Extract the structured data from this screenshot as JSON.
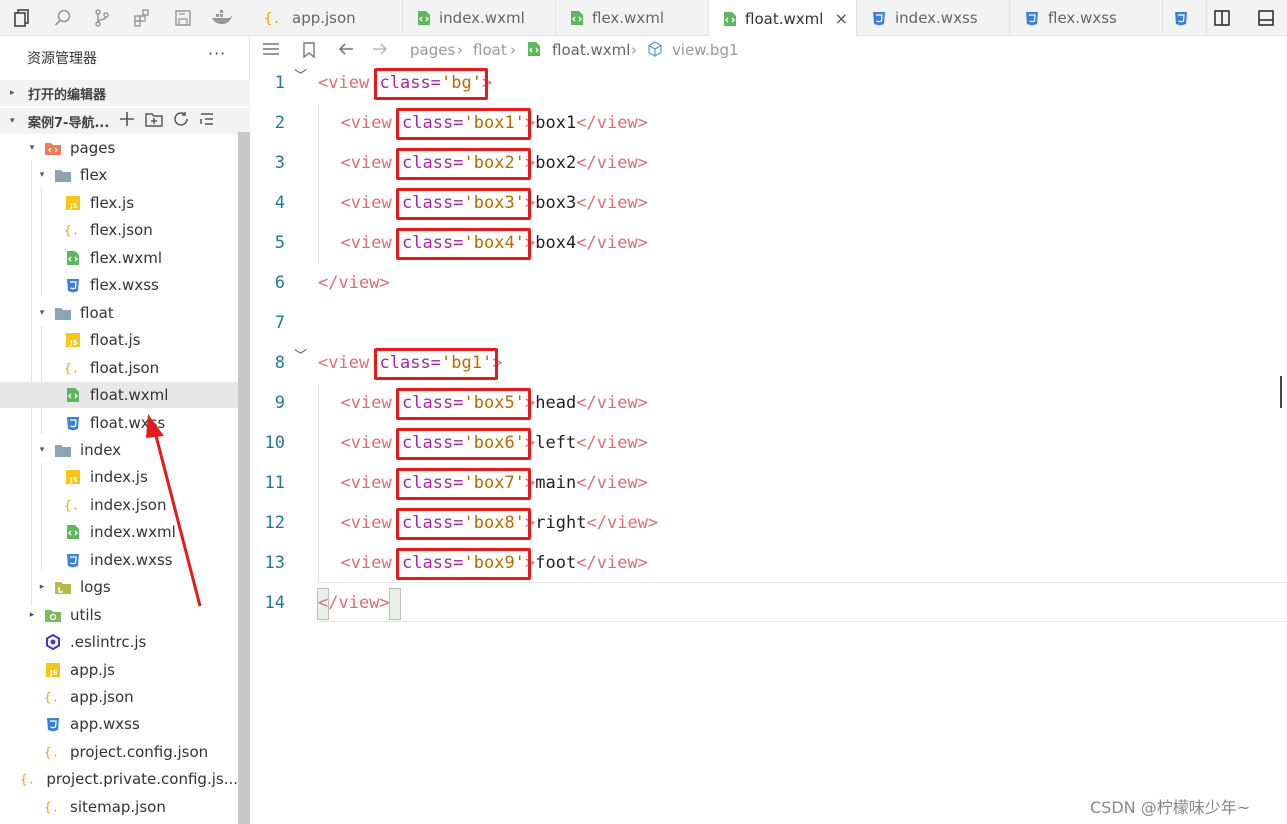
{
  "tabs": [
    {
      "label": "app.json",
      "icon": "json-icon"
    },
    {
      "label": "index.wxml",
      "icon": "wxml-icon"
    },
    {
      "label": "flex.wxml",
      "icon": "wxml-icon"
    },
    {
      "label": "float.wxml",
      "icon": "wxml-icon",
      "active": true,
      "close": "×"
    },
    {
      "label": "index.wxss",
      "icon": "wxss-icon"
    },
    {
      "label": "flex.wxss",
      "icon": "wxss-icon"
    }
  ],
  "sidebar": {
    "title": "资源管理器",
    "more": "···",
    "open_editors": "打开的编辑器",
    "project": "案例7-导航...",
    "tree": [
      {
        "label": "pages",
        "icon": "folder-pages-icon",
        "arrow": "▾"
      },
      {
        "label": "flex",
        "icon": "folder-icon",
        "arrow": "▾"
      },
      {
        "label": "flex.js",
        "icon": "js-icon"
      },
      {
        "label": "flex.json",
        "icon": "json-icon"
      },
      {
        "label": "flex.wxml",
        "icon": "wxml-icon"
      },
      {
        "label": "flex.wxss",
        "icon": "wxss-icon"
      },
      {
        "label": "float",
        "icon": "folder-icon",
        "arrow": "▾"
      },
      {
        "label": "float.js",
        "icon": "js-icon"
      },
      {
        "label": "float.json",
        "icon": "json-icon"
      },
      {
        "label": "float.wxml",
        "icon": "wxml-icon",
        "selected": true
      },
      {
        "label": "float.wxss",
        "icon": "wxss-icon"
      },
      {
        "label": "index",
        "icon": "folder-icon",
        "arrow": "▾"
      },
      {
        "label": "index.js",
        "icon": "js-icon"
      },
      {
        "label": "index.json",
        "icon": "json-icon"
      },
      {
        "label": "index.wxml",
        "icon": "wxml-icon"
      },
      {
        "label": "index.wxss",
        "icon": "wxss-icon"
      },
      {
        "label": "logs",
        "icon": "folder-logs-icon",
        "arrow": "▸"
      },
      {
        "label": "utils",
        "icon": "folder-utils-icon",
        "arrow": "▸"
      },
      {
        "label": ".eslintrc.js",
        "icon": "eslint-icon"
      },
      {
        "label": "app.js",
        "icon": "js-icon"
      },
      {
        "label": "app.json",
        "icon": "json-icon"
      },
      {
        "label": "app.wxss",
        "icon": "wxss-icon"
      },
      {
        "label": "project.config.json",
        "icon": "json-icon"
      },
      {
        "label": "project.private.config.js...",
        "icon": "json-icon"
      },
      {
        "label": "sitemap.json",
        "icon": "json-icon"
      }
    ]
  },
  "breadcrumb": {
    "items": [
      "pages",
      "float",
      "float.wxml",
      "view.bg1"
    ],
    "sep": "›"
  },
  "code": [
    {
      "n": "1",
      "indent": 0,
      "fold": "﹀",
      "parts": [
        [
          "tag",
          "<view"
        ],
        [
          "sp",
          " "
        ],
        [
          "attr",
          "class="
        ],
        [
          "str",
          "'bg'"
        ],
        [
          "tag",
          ">"
        ]
      ]
    },
    {
      "n": "2",
      "indent": 1,
      "parts": [
        [
          "tag",
          "<view"
        ],
        [
          "sp",
          " "
        ],
        [
          "attr",
          "class="
        ],
        [
          "str",
          "'box1'"
        ],
        [
          "tag",
          ">"
        ],
        [
          "txt",
          "box1"
        ],
        [
          "tag",
          "</view>"
        ]
      ]
    },
    {
      "n": "3",
      "indent": 1,
      "parts": [
        [
          "tag",
          "<view"
        ],
        [
          "sp",
          " "
        ],
        [
          "attr",
          "class="
        ],
        [
          "str",
          "'box2'"
        ],
        [
          "tag",
          ">"
        ],
        [
          "txt",
          "box2"
        ],
        [
          "tag",
          "</view>"
        ]
      ]
    },
    {
      "n": "4",
      "indent": 1,
      "parts": [
        [
          "tag",
          "<view"
        ],
        [
          "sp",
          " "
        ],
        [
          "attr",
          "class="
        ],
        [
          "str",
          "'box3'"
        ],
        [
          "tag",
          ">"
        ],
        [
          "txt",
          "box3"
        ],
        [
          "tag",
          "</view>"
        ]
      ]
    },
    {
      "n": "5",
      "indent": 1,
      "parts": [
        [
          "tag",
          "<view"
        ],
        [
          "sp",
          " "
        ],
        [
          "attr",
          "class="
        ],
        [
          "str",
          "'box4'"
        ],
        [
          "tag",
          ">"
        ],
        [
          "txt",
          "box4"
        ],
        [
          "tag",
          "</view>"
        ]
      ]
    },
    {
      "n": "6",
      "indent": 0,
      "parts": [
        [
          "tag",
          "</view>"
        ]
      ]
    },
    {
      "n": "7",
      "indent": 0,
      "parts": []
    },
    {
      "n": "8",
      "indent": 0,
      "fold": "﹀",
      "parts": [
        [
          "tag",
          "<view"
        ],
        [
          "sp",
          " "
        ],
        [
          "attr",
          "class="
        ],
        [
          "str",
          "'bg1'"
        ],
        [
          "tag",
          ">"
        ]
      ]
    },
    {
      "n": "9",
      "indent": 1,
      "parts": [
        [
          "tag",
          "<view"
        ],
        [
          "sp",
          " "
        ],
        [
          "attr",
          "class="
        ],
        [
          "str",
          "'box5'"
        ],
        [
          "tag",
          ">"
        ],
        [
          "txt",
          "head"
        ],
        [
          "tag",
          "</view>"
        ]
      ]
    },
    {
      "n": "10",
      "indent": 1,
      "parts": [
        [
          "tag",
          "<view"
        ],
        [
          "sp",
          " "
        ],
        [
          "attr",
          "class="
        ],
        [
          "str",
          "'box6'"
        ],
        [
          "tag",
          ">"
        ],
        [
          "txt",
          "left"
        ],
        [
          "tag",
          "</view>"
        ]
      ]
    },
    {
      "n": "11",
      "indent": 1,
      "parts": [
        [
          "tag",
          "<view"
        ],
        [
          "sp",
          " "
        ],
        [
          "attr",
          "class="
        ],
        [
          "str",
          "'box7'"
        ],
        [
          "tag",
          ">"
        ],
        [
          "txt",
          "main"
        ],
        [
          "tag",
          "</view>"
        ]
      ]
    },
    {
      "n": "12",
      "indent": 1,
      "parts": [
        [
          "tag",
          "<view"
        ],
        [
          "sp",
          " "
        ],
        [
          "attr",
          "class="
        ],
        [
          "str",
          "'box8'"
        ],
        [
          "tag",
          ">"
        ],
        [
          "txt",
          "right"
        ],
        [
          "tag",
          "</view>"
        ]
      ]
    },
    {
      "n": "13",
      "indent": 1,
      "parts": [
        [
          "tag",
          "<view"
        ],
        [
          "sp",
          " "
        ],
        [
          "attr",
          "class="
        ],
        [
          "str",
          "'box9'"
        ],
        [
          "tag",
          ">"
        ],
        [
          "txt",
          "foot"
        ],
        [
          "tag",
          "</view>"
        ]
      ]
    },
    {
      "n": "14",
      "indent": 0,
      "parts": [
        [
          "tag",
          "</view>"
        ]
      ]
    }
  ],
  "colors": {
    "highlight": "#e51a1a",
    "tag": "#e06c75",
    "attr": "#a626a4",
    "string": "#b76b01"
  },
  "watermark": "CSDN @柠檬味少年~"
}
